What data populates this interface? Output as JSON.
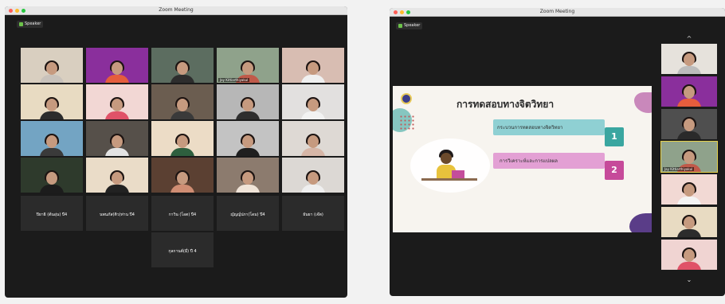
{
  "left_window": {
    "title": "Zoom Meeting",
    "view_button": "Speaker",
    "participants": [
      {
        "name": "",
        "bg": "#d9cfc0",
        "shirt": "#c8c2bb"
      },
      {
        "name": "",
        "bg": "#8a2f9c",
        "shirt": "#e55d3d"
      },
      {
        "name": "",
        "bg": "#5c6d60",
        "shirt": "#2d2d2d"
      },
      {
        "name": "Jay Kittiarthiyakul",
        "bg": "#8fa28b",
        "shirt": "#c05a4a"
      },
      {
        "name": "",
        "bg": "#d8bdb2",
        "shirt": "#f0f0f0"
      },
      {
        "name": "",
        "bg": "#e8dbc2",
        "shirt": "#2c2c2c"
      },
      {
        "name": "",
        "bg": "#f2d7d4",
        "shirt": "#e05268"
      },
      {
        "name": "",
        "bg": "#6b5d50",
        "shirt": "#3a3a3a"
      },
      {
        "name": "",
        "bg": "#b7b7b7",
        "shirt": "#2e2e2e"
      },
      {
        "name": "",
        "bg": "#e2e0df",
        "shirt": "#f2f2f2"
      },
      {
        "name": "",
        "bg": "#73a4c3",
        "shirt": "#3a3a3a"
      },
      {
        "name": "",
        "bg": "#56504a",
        "shirt": "#e3e3e3"
      },
      {
        "name": "",
        "bg": "#ecdcc6",
        "shirt": "#2e5f3e"
      },
      {
        "name": "",
        "bg": "#c3c3c3",
        "shirt": "#1f1f1f"
      },
      {
        "name": "",
        "bg": "#ded9d4",
        "shirt": "#d6b6a7"
      },
      {
        "name": "",
        "bg": "#2e3a2c",
        "shirt": "#1c1c1c"
      },
      {
        "name": "",
        "bg": "#eadcc8",
        "shirt": "#222222"
      },
      {
        "name": "",
        "bg": "#5b4032",
        "shirt": "#cf8d73"
      },
      {
        "name": "",
        "bg": "#8c7b6e",
        "shirt": "#f0e4d8"
      },
      {
        "name": "",
        "bg": "#dcd8d4",
        "shirt": "#efefef"
      }
    ],
    "name_tiles": [
      "ปิยาธิ (ต้นอุ่น) ปี4",
      "นพนภัส(ติว)ท่าน ปี4",
      "กาวิน (โอต) ปี4",
      "ญัญญ์ปภา(โดม) ปี4",
      "ธันยา (เจ๊ต)",
      "กุลกานต์(มี่) ปี 4"
    ]
  },
  "right_window": {
    "title": "Zoom Meeting",
    "view_button": "Speaker",
    "slide": {
      "title": "การทดสอบทางจิตวิทยา",
      "item1": "กระบวนการทดสอบทางจิตวิทยา",
      "item2": "การวิเคราะห์และการแปลผล",
      "num1": "1",
      "num2": "2"
    },
    "strip": [
      {
        "bg": "#e6e2dc",
        "shirt": "#bcbcbc"
      },
      {
        "bg": "#8a2f9c",
        "shirt": "#e55d3d"
      },
      {
        "bg": "#4f4f4f",
        "shirt": "#2a2a2a"
      },
      {
        "bg": "#8fa28b",
        "shirt": "#c05a4a"
      },
      {
        "bg": "#f2d9d4",
        "shirt": "#f4f4f4"
      },
      {
        "bg": "#e8dbc2",
        "shirt": "#2c2c2c"
      },
      {
        "bg": "#f0d4d2",
        "shirt": "#e05268"
      }
    ],
    "strip_active_label": "Jay Kittiarthiyakul"
  }
}
